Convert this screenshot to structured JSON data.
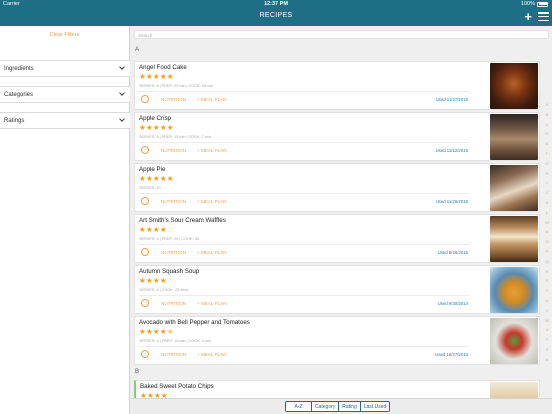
{
  "status": {
    "carrier": "Carrier",
    "time": "12:37 PM",
    "battery": "100%"
  },
  "header": {
    "title": "RECIPES",
    "add_icon": "plus-icon",
    "menu_icon": "hamburger-icon"
  },
  "sidebar": {
    "clear_filters": "Clear Filters",
    "filters": [
      {
        "label": "Ingredients"
      },
      {
        "label": "Categories"
      },
      {
        "label": "Ratings"
      }
    ]
  },
  "search": {
    "placeholder": "Search"
  },
  "sections": [
    {
      "letter": "A",
      "recipes": [
        {
          "name": "Angel Food Cake",
          "rating": 5,
          "meta": "SERVES: 8 | PREP: 20 min | COOK: 45 min",
          "nutrition": "NUTRITION",
          "meal_plan": "+ MEAL PLAN",
          "used": "Used 11/27/2016"
        },
        {
          "name": "Apple Crisp",
          "rating": 5,
          "meta": "SERVES: 8 | PREP: 15 min | COOK: 7 min",
          "nutrition": "NUTRITION",
          "meal_plan": "+ MEAL PLAN",
          "used": "Used 11/12/2015"
        },
        {
          "name": "Apple Pie",
          "rating": 5,
          "meta": "SERVES: 10",
          "nutrition": "NUTRITION",
          "meal_plan": "+ MEAL PLAN",
          "used": "Used 11/26/2015"
        },
        {
          "name": "Art Smith's Sour Cream Waffles",
          "rating": 4,
          "meta": "SERVES: 4 | PREP: 20 | COOK: 45",
          "nutrition": "NUTRITION",
          "meal_plan": "+ MEAL PLAN",
          "used": "Used 9/26/2015"
        },
        {
          "name": "Autumn Squash Soup",
          "rating": 4,
          "meta": "SERVES: 8 | COOK: 20 mins",
          "nutrition": "NUTRITION",
          "meal_plan": "+ MEAL PLAN",
          "used": "Used 9/30/2014"
        },
        {
          "name": "Avocado with Bell Pepper and Tomatoes",
          "rating": 4.5,
          "meta": "SERVES: 4 | PREP: 10 min | COOK: 0 min",
          "nutrition": "NUTRITION",
          "meal_plan": "+ MEAL PLAN",
          "used": "Used 10/27/2013"
        }
      ]
    },
    {
      "letter": "B",
      "recipes": [
        {
          "name": "Baked Sweet Potato Chips",
          "rating": 4
        }
      ]
    }
  ],
  "index_letters": [
    "A",
    "B",
    "C",
    "D",
    "E",
    "F",
    "G",
    "H",
    "I",
    "J",
    "K",
    "L",
    "M",
    "N",
    "O",
    "P",
    "Q",
    "R",
    "S",
    "T",
    "U",
    "V",
    "W",
    "X",
    "Y",
    "Z",
    "#"
  ],
  "sort_tabs": [
    "A-Z",
    "Category",
    "Rating",
    "Last Used"
  ],
  "sort_selected": "A-Z"
}
